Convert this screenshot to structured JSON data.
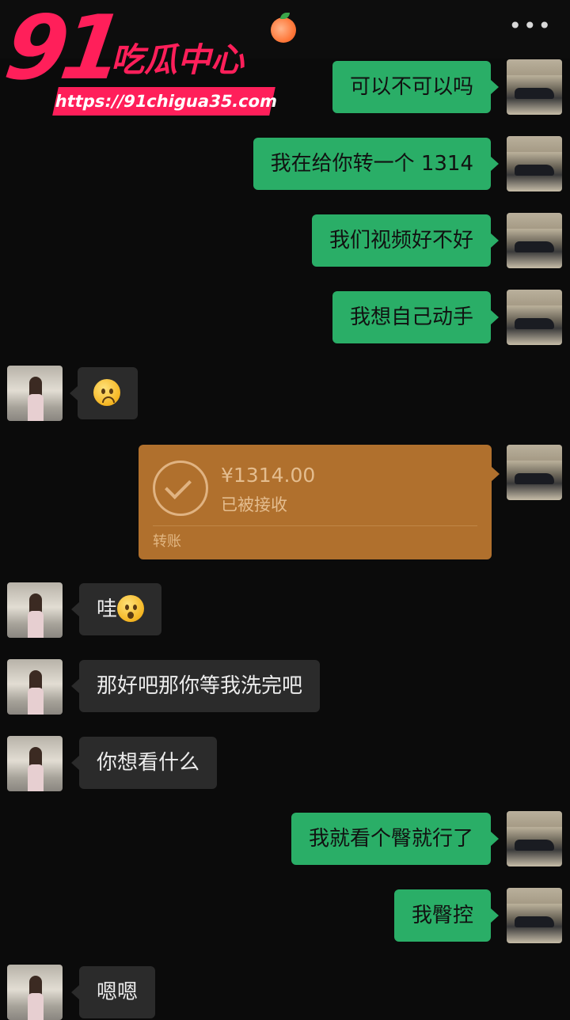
{
  "header": {
    "more_label": "•••"
  },
  "watermark": {
    "number": "91",
    "chinese": "吃瓜中心",
    "url": "https://91chigua35.com"
  },
  "messages": [
    {
      "text": "可以不可以吗"
    },
    {
      "text": "我在给你转一个 1314"
    },
    {
      "text": "我们视频好不好"
    },
    {
      "text": "我想自己动手"
    },
    {
      "emoji": "disappointed-face"
    },
    {
      "transfer": {
        "amount": "¥1314.00",
        "status": "已被接收",
        "label": "转账"
      }
    },
    {
      "text": "哇",
      "emoji": "surprised-face"
    },
    {
      "text": "那好吧那你等我洗完吧"
    },
    {
      "text": "你想看什么"
    },
    {
      "text": "我就看个臀就行了"
    },
    {
      "text": "我臀控"
    },
    {
      "text": "嗯嗯"
    }
  ],
  "colors": {
    "outgoing_bubble": "#2aae67",
    "incoming_bubble": "#2b2b2b",
    "transfer_card": "#b0702d",
    "watermark": "#ff1f5a"
  }
}
